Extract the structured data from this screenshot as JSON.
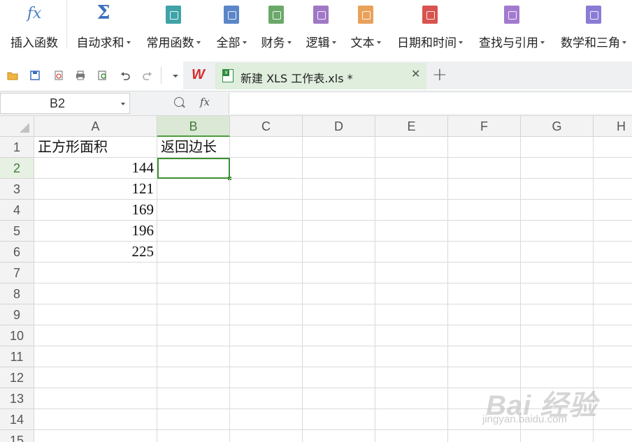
{
  "ribbon": {
    "items": [
      {
        "label": "插入函数",
        "icon": "fx-icon",
        "color": "#4a7fc4",
        "dropdown": false
      },
      {
        "label": "自动求和",
        "icon": "sigma-icon",
        "color": "#3b6fbf",
        "dropdown": true
      },
      {
        "label": "常用函数",
        "icon": "star-icon",
        "color": "#3fa3a8",
        "dropdown": true
      },
      {
        "label": "全部",
        "icon": "list-icon",
        "color": "#5b86c8",
        "dropdown": true
      },
      {
        "label": "财务",
        "icon": "finance-icon",
        "color": "#6aa96a",
        "dropdown": true
      },
      {
        "label": "逻辑",
        "icon": "question-icon",
        "color": "#a078c6",
        "dropdown": true
      },
      {
        "label": "文本",
        "icon": "text-a-icon",
        "color": "#e9a15a",
        "dropdown": true
      },
      {
        "label": "日期和时间",
        "icon": "clock-icon",
        "color": "#d9534f",
        "dropdown": true
      },
      {
        "label": "查找与引用",
        "icon": "search-book-icon",
        "color": "#a37ad0",
        "dropdown": true
      },
      {
        "label": "数学和三角",
        "icon": "theta-icon",
        "color": "#8a7bd6",
        "dropdown": true
      }
    ]
  },
  "toolbar": {
    "wps_logo": "W",
    "document_tab": {
      "title": "新建 XLS 工作表.xls *",
      "close": "✕"
    },
    "new_tab": "+"
  },
  "formula_bar": {
    "name_box": "B2",
    "fx_label": "fx",
    "content": ""
  },
  "sheet": {
    "columns": [
      "A",
      "B",
      "C",
      "D",
      "E",
      "F",
      "G",
      "H"
    ],
    "rows": [
      "1",
      "2",
      "3",
      "4",
      "5",
      "6",
      "7",
      "8",
      "9",
      "10",
      "11",
      "12",
      "13",
      "14",
      "15"
    ],
    "selected_cell": "B2",
    "cells": {
      "A1": "正方形面积",
      "B1": "返回边长",
      "A2": "144",
      "A3": "121",
      "A4": "169",
      "A5": "196",
      "A6": "225"
    }
  },
  "watermark": {
    "brand": "Bai 经验",
    "url": "jingyan.baidu.com"
  }
}
